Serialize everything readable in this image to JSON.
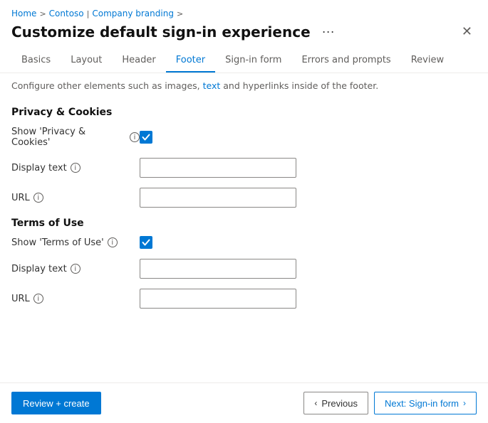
{
  "breadcrumb": {
    "home": "Home",
    "contoso": "Contoso",
    "section": "Company branding",
    "sep1": ">",
    "sep2": ">",
    "sep3": ">"
  },
  "header": {
    "title": "Customize default sign-in experience",
    "more_label": "···",
    "close_label": "✕"
  },
  "tabs": [
    {
      "id": "basics",
      "label": "Basics",
      "active": false
    },
    {
      "id": "layout",
      "label": "Layout",
      "active": false
    },
    {
      "id": "header",
      "label": "Header",
      "active": false
    },
    {
      "id": "footer",
      "label": "Footer",
      "active": true
    },
    {
      "id": "signin-form",
      "label": "Sign-in form",
      "active": false
    },
    {
      "id": "errors-prompts",
      "label": "Errors and prompts",
      "active": false
    },
    {
      "id": "review",
      "label": "Review",
      "active": false
    }
  ],
  "description": "Configure other elements such as images, text and hyperlinks inside of the footer.",
  "privacy_section": {
    "title": "Privacy & Cookies",
    "show_label": "Show 'Privacy & Cookies'",
    "show_checked": true,
    "display_text_label": "Display text",
    "display_text_value": "",
    "display_text_placeholder": "",
    "url_label": "URL",
    "url_value": "",
    "url_placeholder": ""
  },
  "terms_section": {
    "title": "Terms of Use",
    "show_label": "Show 'Terms of Use'",
    "show_checked": true,
    "display_text_label": "Display text",
    "display_text_value": "",
    "display_text_placeholder": "",
    "url_label": "URL",
    "url_value": "",
    "url_placeholder": ""
  },
  "footer": {
    "review_create_label": "Review + create",
    "previous_label": "Previous",
    "next_label": "Next: Sign-in form",
    "prev_arrow": "‹",
    "next_arrow": "›"
  },
  "icons": {
    "info": "i",
    "checkmark": "✓",
    "close": "✕",
    "more": "···"
  }
}
